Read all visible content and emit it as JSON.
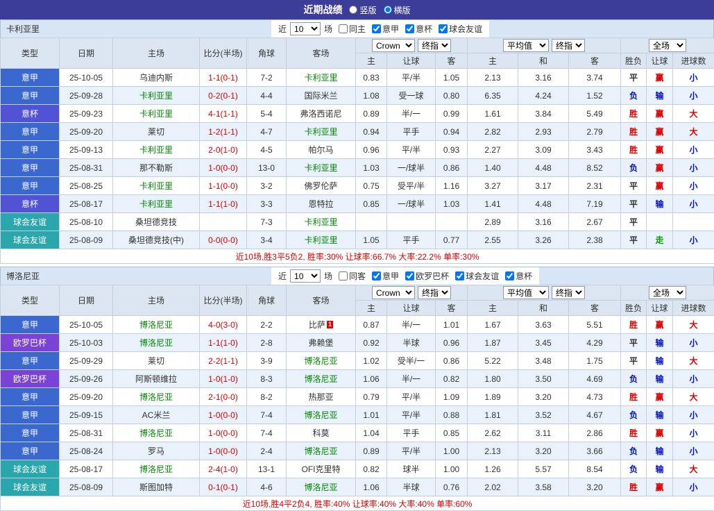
{
  "topbar": {
    "title": "近期战绩",
    "options": [
      {
        "label": "竖版",
        "selected": false
      },
      {
        "label": "横版",
        "selected": true
      }
    ]
  },
  "colors": {
    "topbar_bg": "#3c3c99",
    "team_bar_bg": "#d7e5f4",
    "header_bg": "#dce6f2",
    "alt_row_bg": "#e9f1fa",
    "score_red": "#dd0000",
    "team_highlight_green": "#008800",
    "league_colors": {
      "意甲": "#3b68cf",
      "意杯": "#5152d6",
      "欧罗巴杯": "#7a42d6",
      "球会友谊": "#2aa7ad"
    },
    "result_colors": {
      "胜": "#dd0000",
      "赢": "#dd0000",
      "大": "#dd0000",
      "负": "#0010cc",
      "输": "#0010cc",
      "小": "#0010cc",
      "平": "#333333",
      "走": "#009900"
    }
  },
  "tables": [
    {
      "team": "卡利亚里",
      "filter": {
        "near_label": "近",
        "count": "10",
        "games_label": "场",
        "same": {
          "label": "同主",
          "checked": false
        },
        "leagues": [
          {
            "label": "意甲",
            "checked": true
          },
          {
            "label": "意杯",
            "checked": true
          },
          {
            "label": "球会友谊",
            "checked": true
          }
        ]
      },
      "header": {
        "cols": [
          "类型",
          "日期",
          "主场",
          "比分(半场)",
          "角球",
          "客场"
        ],
        "company": "Crown",
        "company_ref": "终指",
        "avg": "平均值",
        "avg_ref": "终指",
        "scope": "全场",
        "sub": [
          "主",
          "让球",
          "客",
          "主",
          "和",
          "客",
          "胜负",
          "让球",
          "进球数"
        ]
      },
      "rows": [
        {
          "league": "意甲",
          "date": "25-10-05",
          "home": "乌迪内斯",
          "home_hl": false,
          "score": "1-1(0-1)",
          "corner": "7-2",
          "away": "卡利亚里",
          "away_hl": true,
          "away_badge": "",
          "o_h": "0.83",
          "o_line": "平/半",
          "o_a": "1.05",
          "e_h": "2.13",
          "e_d": "3.16",
          "e_a": "3.74",
          "res": [
            "平",
            "赢",
            "小"
          ]
        },
        {
          "league": "意甲",
          "date": "25-09-28",
          "home": "卡利亚里",
          "home_hl": true,
          "score": "0-2(0-1)",
          "corner": "4-4",
          "away": "国际米兰",
          "away_hl": false,
          "away_badge": "",
          "o_h": "1.08",
          "o_line": "受一球",
          "o_a": "0.80",
          "e_h": "6.35",
          "e_d": "4.24",
          "e_a": "1.52",
          "res": [
            "负",
            "输",
            "小"
          ]
        },
        {
          "league": "意杯",
          "date": "25-09-23",
          "home": "卡利亚里",
          "home_hl": true,
          "score": "4-1(1-1)",
          "corner": "5-4",
          "away": "弗洛西诺尼",
          "away_hl": false,
          "away_badge": "",
          "o_h": "0.89",
          "o_line": "半/一",
          "o_a": "0.99",
          "e_h": "1.61",
          "e_d": "3.84",
          "e_a": "5.49",
          "res": [
            "胜",
            "赢",
            "大"
          ]
        },
        {
          "league": "意甲",
          "date": "25-09-20",
          "home": "莱切",
          "home_hl": false,
          "score": "1-2(1-1)",
          "corner": "4-7",
          "away": "卡利亚里",
          "away_hl": true,
          "away_badge": "",
          "o_h": "0.94",
          "o_line": "平手",
          "o_a": "0.94",
          "e_h": "2.82",
          "e_d": "2.93",
          "e_a": "2.79",
          "res": [
            "胜",
            "赢",
            "大"
          ]
        },
        {
          "league": "意甲",
          "date": "25-09-13",
          "home": "卡利亚里",
          "home_hl": true,
          "score": "2-0(1-0)",
          "corner": "4-5",
          "away": "帕尔马",
          "away_hl": false,
          "away_badge": "",
          "o_h": "0.96",
          "o_line": "平/半",
          "o_a": "0.93",
          "e_h": "2.27",
          "e_d": "3.09",
          "e_a": "3.43",
          "res": [
            "胜",
            "赢",
            "小"
          ]
        },
        {
          "league": "意甲",
          "date": "25-08-31",
          "home": "那不勒斯",
          "home_hl": false,
          "score": "1-0(0-0)",
          "corner": "13-0",
          "away": "卡利亚里",
          "away_hl": true,
          "away_badge": "",
          "o_h": "1.03",
          "o_line": "一/球半",
          "o_a": "0.86",
          "e_h": "1.40",
          "e_d": "4.48",
          "e_a": "8.52",
          "res": [
            "负",
            "赢",
            "小"
          ]
        },
        {
          "league": "意甲",
          "date": "25-08-25",
          "home": "卡利亚里",
          "home_hl": true,
          "score": "1-1(0-0)",
          "corner": "3-2",
          "away": "佛罗伦萨",
          "away_hl": false,
          "away_badge": "",
          "o_h": "0.75",
          "o_line": "受平/半",
          "o_a": "1.16",
          "e_h": "3.27",
          "e_d": "3.17",
          "e_a": "2.31",
          "res": [
            "平",
            "赢",
            "小"
          ]
        },
        {
          "league": "意杯",
          "date": "25-08-17",
          "home": "卡利亚里",
          "home_hl": true,
          "score": "1-1(1-0)",
          "corner": "3-3",
          "away": "恩特拉",
          "away_hl": false,
          "away_badge": "",
          "o_h": "0.85",
          "o_line": "一/球半",
          "o_a": "1.03",
          "e_h": "1.41",
          "e_d": "4.48",
          "e_a": "7.19",
          "res": [
            "平",
            "输",
            "小"
          ]
        },
        {
          "league": "球会友谊",
          "date": "25-08-10",
          "home": "桑坦德竞技",
          "home_hl": false,
          "score": "",
          "corner": "7-3",
          "away": "卡利亚里",
          "away_hl": true,
          "away_badge": "",
          "o_h": "",
          "o_line": "",
          "o_a": "",
          "e_h": "2.89",
          "e_d": "3.16",
          "e_a": "2.67",
          "res": [
            "平",
            "",
            ""
          ]
        },
        {
          "league": "球会友谊",
          "date": "25-08-09",
          "home": "桑坦德竞技(中)",
          "home_hl": false,
          "score": "0-0(0-0)",
          "corner": "3-4",
          "away": "卡利亚里",
          "away_hl": true,
          "away_badge": "",
          "o_h": "1.05",
          "o_line": "平手",
          "o_a": "0.77",
          "e_h": "2.55",
          "e_d": "3.26",
          "e_a": "2.38",
          "res": [
            "平",
            "走",
            "小"
          ]
        }
      ],
      "summary": "近10场,胜3平5负2, 胜率:30% 让球率:66.7% 大率:22.2% 单率:30%"
    },
    {
      "team": "博洛尼亚",
      "filter": {
        "near_label": "近",
        "count": "10",
        "games_label": "场",
        "same": {
          "label": "同客",
          "checked": false
        },
        "leagues": [
          {
            "label": "意甲",
            "checked": true
          },
          {
            "label": "欧罗巴杯",
            "checked": true
          },
          {
            "label": "球会友谊",
            "checked": true
          },
          {
            "label": "意杯",
            "checked": true
          }
        ]
      },
      "header": {
        "cols": [
          "类型",
          "日期",
          "主场",
          "比分(半场)",
          "角球",
          "客场"
        ],
        "company": "Crown",
        "company_ref": "终指",
        "avg": "平均值",
        "avg_ref": "终指",
        "scope": "全场",
        "sub": [
          "主",
          "让球",
          "客",
          "主",
          "和",
          "客",
          "胜负",
          "让球",
          "进球数"
        ]
      },
      "rows": [
        {
          "league": "意甲",
          "date": "25-10-05",
          "home": "博洛尼亚",
          "home_hl": true,
          "score": "4-0(3-0)",
          "corner": "2-2",
          "away": "比萨",
          "away_hl": false,
          "away_badge": "1",
          "o_h": "0.87",
          "o_line": "半/一",
          "o_a": "1.01",
          "e_h": "1.67",
          "e_d": "3.63",
          "e_a": "5.51",
          "res": [
            "胜",
            "赢",
            "大"
          ]
        },
        {
          "league": "欧罗巴杯",
          "date": "25-10-03",
          "home": "博洛尼亚",
          "home_hl": true,
          "score": "1-1(1-0)",
          "corner": "2-8",
          "away": "弗赖堡",
          "away_hl": false,
          "away_badge": "",
          "o_h": "0.92",
          "o_line": "半球",
          "o_a": "0.96",
          "e_h": "1.87",
          "e_d": "3.45",
          "e_a": "4.29",
          "res": [
            "平",
            "输",
            "小"
          ]
        },
        {
          "league": "意甲",
          "date": "25-09-29",
          "home": "莱切",
          "home_hl": false,
          "score": "2-2(1-1)",
          "corner": "3-9",
          "away": "博洛尼亚",
          "away_hl": true,
          "away_badge": "",
          "o_h": "1.02",
          "o_line": "受半/一",
          "o_a": "0.86",
          "e_h": "5.22",
          "e_d": "3.48",
          "e_a": "1.75",
          "res": [
            "平",
            "输",
            "大"
          ]
        },
        {
          "league": "欧罗巴杯",
          "date": "25-09-26",
          "home": "阿斯顿维拉",
          "home_hl": false,
          "score": "1-0(1-0)",
          "corner": "8-3",
          "away": "博洛尼亚",
          "away_hl": true,
          "away_badge": "",
          "o_h": "1.06",
          "o_line": "半/一",
          "o_a": "0.82",
          "e_h": "1.80",
          "e_d": "3.50",
          "e_a": "4.69",
          "res": [
            "负",
            "输",
            "小"
          ]
        },
        {
          "league": "意甲",
          "date": "25-09-20",
          "home": "博洛尼亚",
          "home_hl": true,
          "score": "2-1(0-0)",
          "corner": "8-2",
          "away": "热那亚",
          "away_hl": false,
          "away_badge": "",
          "o_h": "0.79",
          "o_line": "平/半",
          "o_a": "1.09",
          "e_h": "1.89",
          "e_d": "3.20",
          "e_a": "4.73",
          "res": [
            "胜",
            "赢",
            "大"
          ]
        },
        {
          "league": "意甲",
          "date": "25-09-15",
          "home": "AC米兰",
          "home_hl": false,
          "score": "1-0(0-0)",
          "corner": "7-4",
          "away": "博洛尼亚",
          "away_hl": true,
          "away_badge": "",
          "o_h": "1.01",
          "o_line": "平/半",
          "o_a": "0.88",
          "e_h": "1.81",
          "e_d": "3.52",
          "e_a": "4.67",
          "res": [
            "负",
            "输",
            "小"
          ]
        },
        {
          "league": "意甲",
          "date": "25-08-31",
          "home": "博洛尼亚",
          "home_hl": true,
          "score": "1-0(0-0)",
          "corner": "7-4",
          "away": "科莫",
          "away_hl": false,
          "away_badge": "",
          "o_h": "1.04",
          "o_line": "平手",
          "o_a": "0.85",
          "e_h": "2.62",
          "e_d": "3.11",
          "e_a": "2.86",
          "res": [
            "胜",
            "赢",
            "小"
          ]
        },
        {
          "league": "意甲",
          "date": "25-08-24",
          "home": "罗马",
          "home_hl": false,
          "score": "1-0(0-0)",
          "corner": "2-4",
          "away": "博洛尼亚",
          "away_hl": true,
          "away_badge": "",
          "o_h": "0.89",
          "o_line": "平/半",
          "o_a": "1.00",
          "e_h": "2.13",
          "e_d": "3.20",
          "e_a": "3.66",
          "res": [
            "负",
            "输",
            "小"
          ]
        },
        {
          "league": "球会友谊",
          "date": "25-08-17",
          "home": "博洛尼亚",
          "home_hl": true,
          "score": "2-4(1-0)",
          "corner": "13-1",
          "away": "OFI克里特",
          "away_hl": false,
          "away_badge": "",
          "o_h": "0.82",
          "o_line": "球半",
          "o_a": "1.00",
          "e_h": "1.26",
          "e_d": "5.57",
          "e_a": "8.54",
          "res": [
            "负",
            "输",
            "大"
          ]
        },
        {
          "league": "球会友谊",
          "date": "25-08-09",
          "home": "斯图加特",
          "home_hl": false,
          "score": "0-1(0-1)",
          "corner": "4-6",
          "away": "博洛尼亚",
          "away_hl": true,
          "away_badge": "",
          "o_h": "1.06",
          "o_line": "半球",
          "o_a": "0.76",
          "e_h": "2.02",
          "e_d": "3.58",
          "e_a": "3.20",
          "res": [
            "胜",
            "赢",
            "小"
          ]
        }
      ],
      "summary": "近10场,胜4平2负4, 胜率:40% 让球率:40% 大率:40% 单率:60%"
    }
  ]
}
